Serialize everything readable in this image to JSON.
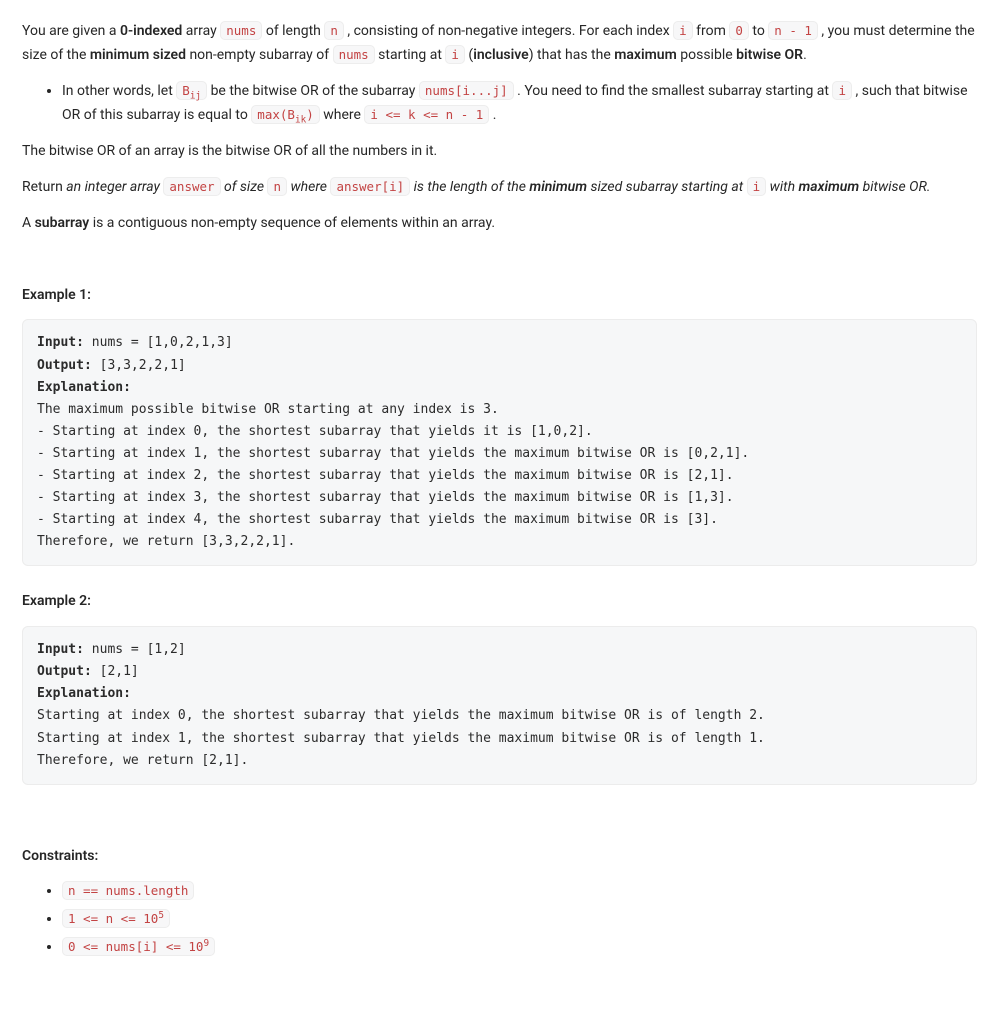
{
  "p1": {
    "t1": "You are given a ",
    "b1": "0-indexed",
    "t2": " array ",
    "c1": "nums",
    "t3": " of length ",
    "c2": "n",
    "t4": " , consisting of non-negative integers. For each index ",
    "c3": "i",
    "t5": " from ",
    "c4": "0",
    "t6": " to ",
    "c5": "n - 1",
    "t7": " , you must determine the size of the ",
    "b2": "minimum sized",
    "t8": " non-empty subarray of ",
    "c6": "nums",
    "t9": " starting at ",
    "c7": "i",
    "t10": " (",
    "b3": "inclusive",
    "t11": ") that has the ",
    "b4": "maximum",
    "t12": " possible ",
    "b5": "bitwise OR",
    "t13": "."
  },
  "li1": {
    "t1": "In other words, let ",
    "c1a": "B",
    "c1b": "ij",
    "t2": " be the bitwise OR of the subarray ",
    "c2": "nums[i...j]",
    "t3": " . You need to find the smallest subarray starting at ",
    "c3": "i",
    "t4": " , such that bitwise OR of this subarray is equal to ",
    "c4a": "max(B",
    "c4b": "ik",
    "c4c": ")",
    "t5": " where ",
    "c5": "i <= k <= n - 1",
    "t6": " ."
  },
  "p2": "The bitwise OR of an array is the bitwise OR of all the numbers in it.",
  "p3": {
    "t1": "Return ",
    "i1": "an integer array ",
    "c1": "answer",
    "i2": " of size ",
    "c2": "n",
    "i3": " where ",
    "c3": "answer[i]",
    "i4": " is the length of the ",
    "bi1": "minimum",
    "i5": " sized subarray starting at ",
    "c4": "i",
    "i6": " with ",
    "bi2": "maximum",
    "i7": " bitwise OR."
  },
  "p4": {
    "t1": "A ",
    "b1": "subarray",
    "t2": " is a contiguous non-empty sequence of elements within an array."
  },
  "ex1": {
    "heading": "Example 1:",
    "code": "Input: nums = [1,0,2,1,3]\nOutput: [3,3,2,2,1]\nExplanation:\nThe maximum possible bitwise OR starting at any index is 3.\n- Starting at index 0, the shortest subarray that yields it is [1,0,2].\n- Starting at index 1, the shortest subarray that yields the maximum bitwise OR is [0,2,1].\n- Starting at index 2, the shortest subarray that yields the maximum bitwise OR is [2,1].\n- Starting at index 3, the shortest subarray that yields the maximum bitwise OR is [1,3].\n- Starting at index 4, the shortest subarray that yields the maximum bitwise OR is [3].\nTherefore, we return [3,3,2,2,1].",
    "bold_input": "Input:",
    "bold_output": "Output:",
    "bold_explanation": "Explanation:"
  },
  "ex2": {
    "heading": "Example 2:",
    "code": "Input: nums = [1,2]\nOutput: [2,1]\nExplanation:\nStarting at index 0, the shortest subarray that yields the maximum bitwise OR is of length 2.\nStarting at index 1, the shortest subarray that yields the maximum bitwise OR is of length 1.\nTherefore, we return [2,1]."
  },
  "constraints": {
    "heading": "Constraints:",
    "items": {
      "c1": "n == nums.length",
      "c2a": "1 <= n <= 10",
      "c2b": "5",
      "c3a": "0 <= nums[i] <= 10",
      "c3b": "9"
    }
  }
}
